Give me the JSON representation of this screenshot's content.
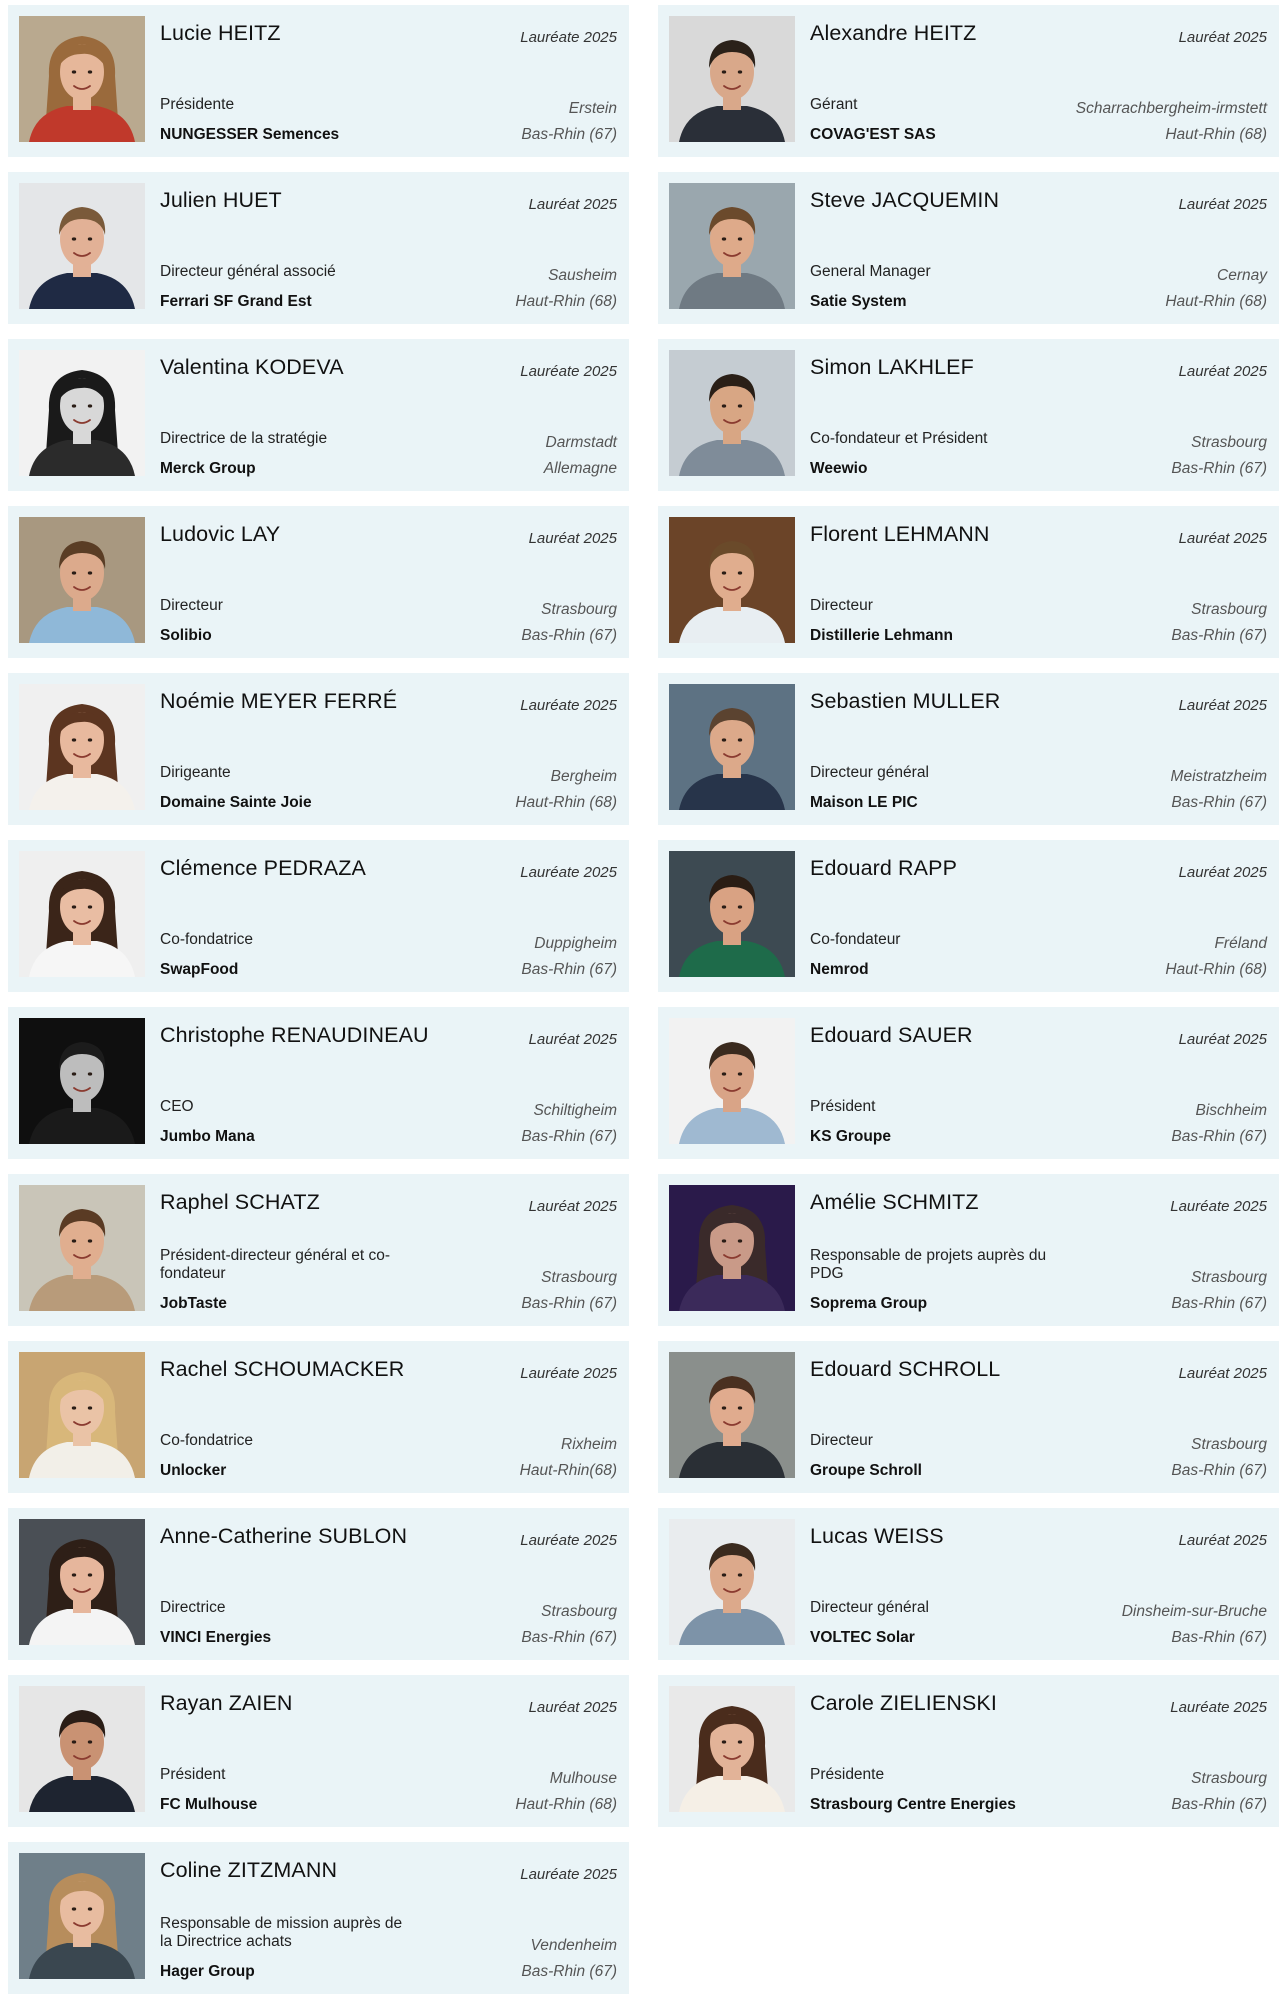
{
  "laureates": [
    {
      "name": "Lucie HEITZ",
      "badge": "Lauréate 2025",
      "role": "Présidente",
      "company": "NUNGESSER Semences",
      "city": "Erstein",
      "department": "Bas-Rhin (67)",
      "photo": {
        "bg": "#b9a98f",
        "skin": "#e6b79a",
        "hair": "#9a6a3c",
        "clothes": "#c0392b",
        "hair_long": true
      }
    },
    {
      "name": "Alexandre HEITZ",
      "badge": "Lauréat 2025",
      "role": "Gérant",
      "company": "COVAG'EST SAS",
      "city": "Scharrachbergheim-irmstett",
      "department": "Haut-Rhin (68)",
      "photo": {
        "bg": "#d9d9d9",
        "skin": "#d9a88a",
        "hair": "#2b2119",
        "clothes": "#2a2f38",
        "hair_long": false
      }
    },
    {
      "name": "Julien HUET",
      "badge": "Lauréat 2025",
      "role": "Directeur général associé",
      "company": "Ferrari SF Grand Est",
      "city": "Sausheim",
      "department": "Haut-Rhin (68)",
      "photo": {
        "bg": "#e4e6e8",
        "skin": "#e2b196",
        "hair": "#7a5a3a",
        "clothes": "#1f2a44",
        "hair_long": false
      }
    },
    {
      "name": "Steve JACQUEMIN",
      "badge": "Lauréat 2025",
      "role": "General Manager",
      "company": "Satie System",
      "city": "Cernay",
      "department": "Haut-Rhin (68)",
      "photo": {
        "bg": "#9aa7ae",
        "skin": "#deaa8a",
        "hair": "#6b4a2c",
        "clothes": "#6f7a83",
        "hair_long": false
      }
    },
    {
      "name": "Valentina KODEVA",
      "badge": "Lauréate 2025",
      "role": "Directrice de la stratégie",
      "company": "Merck Group",
      "city": "Darmstadt",
      "department": "Allemagne",
      "photo": {
        "bg": "#f2f2f2",
        "skin": "#d8d8d8",
        "hair": "#1a1a1a",
        "clothes": "#2b2b2b",
        "hair_long": true
      }
    },
    {
      "name": "Simon LAKHLEF",
      "badge": "Lauréat 2025",
      "role": "Co-fondateur et Président",
      "company": "Weewio",
      "city": "Strasbourg",
      "department": "Bas-Rhin (67)",
      "photo": {
        "bg": "#c5ccd2",
        "skin": "#d8a684",
        "hair": "#2a1f17",
        "clothes": "#7f8c99",
        "hair_long": false
      }
    },
    {
      "name": "Ludovic LAY",
      "badge": "Lauréat 2025",
      "role": "Directeur",
      "company": "Solibio",
      "city": "Strasbourg",
      "department": "Bas-Rhin (67)",
      "photo": {
        "bg": "#a89880",
        "skin": "#dcaa8c",
        "hair": "#5a3d25",
        "clothes": "#8fb8d8",
        "hair_long": false
      }
    },
    {
      "name": "Florent LEHMANN",
      "badge": "Lauréat 2025",
      "role": "Directeur",
      "company": "Distillerie Lehmann",
      "city": "Strasbourg",
      "department": "Bas-Rhin (67)",
      "photo": {
        "bg": "#6b4428",
        "skin": "#e0ad8e",
        "hair": "#6a4a2a",
        "clothes": "#e8eef2",
        "hair_long": false
      }
    },
    {
      "name": "Noémie MEYER FERRÉ",
      "badge": "Lauréate 2025",
      "role": "Dirigeante",
      "company": "Domaine Sainte Joie",
      "city": "Bergheim",
      "department": "Haut-Rhin (68)",
      "photo": {
        "bg": "#f0f0f0",
        "skin": "#e8b99e",
        "hair": "#5c3520",
        "clothes": "#f4f1ec",
        "hair_long": true
      }
    },
    {
      "name": "Sebastien MULLER",
      "badge": "Lauréat 2025",
      "role": "Directeur général",
      "company": "Maison LE PIC",
      "city": "Meistratzheim",
      "department": "Bas-Rhin (67)",
      "photo": {
        "bg": "#5d7283",
        "skin": "#dca98a",
        "hair": "#5b4330",
        "clothes": "#27344a",
        "hair_long": false
      }
    },
    {
      "name": "Clémence PEDRAZA",
      "badge": "Lauréate 2025",
      "role": "Co-fondatrice",
      "company": "SwapFood",
      "city": "Duppigheim",
      "department": "Bas-Rhin (67)",
      "photo": {
        "bg": "#efefef",
        "skin": "#e9bda3",
        "hair": "#3b2519",
        "clothes": "#f6f6f6",
        "hair_long": true
      }
    },
    {
      "name": "Edouard RAPP",
      "badge": "Lauréat 2025",
      "role": "Co-fondateur",
      "company": "Nemrod",
      "city": "Fréland",
      "department": "Haut-Rhin (68)",
      "photo": {
        "bg": "#3d4a52",
        "skin": "#d9a283",
        "hair": "#2a1d14",
        "clothes": "#1e6b4a",
        "hair_long": false
      }
    },
    {
      "name": "Christophe RENAUDINEAU",
      "badge": "Lauréat 2025",
      "role": "CEO",
      "company": "Jumbo Mana",
      "city": "Schiltigheim",
      "department": "Bas-Rhin (67)",
      "photo": {
        "bg": "#0f0f0f",
        "skin": "#bdbdbd",
        "hair": "#1c1c1c",
        "clothes": "#1a1a1a",
        "hair_long": false
      }
    },
    {
      "name": "Edouard SAUER",
      "badge": "Lauréat 2025",
      "role": "Président",
      "company": "KS Groupe",
      "city": "Bischheim",
      "department": "Bas-Rhin (67)",
      "photo": {
        "bg": "#f2f2f2",
        "skin": "#d9a487",
        "hair": "#3a2a1e",
        "clothes": "#9fb9d1",
        "hair_long": false
      }
    },
    {
      "name": "Raphel SCHATZ",
      "badge": "Lauréat 2025",
      "role": "Président-directeur général et co-fondateur",
      "company": "JobTaste",
      "city": "Strasbourg",
      "department": "Bas-Rhin (67)",
      "photo": {
        "bg": "#c9c5b8",
        "skin": "#e0ae8f",
        "hair": "#5a3b24",
        "clothes": "#b89b7a",
        "hair_long": false
      }
    },
    {
      "name": "Amélie SCHMITZ",
      "badge": "Lauréate 2025",
      "role": "Responsable de projets auprès du PDG",
      "company": "Soprema Group",
      "city": "Strasbourg",
      "department": "Bas-Rhin (67)",
      "photo": {
        "bg": "#2a1a4a",
        "skin": "#c99a88",
        "hair": "#3a2a2a",
        "clothes": "#3b2a5a",
        "hair_long": true
      }
    },
    {
      "name": "Rachel SCHOUMACKER",
      "badge": "Lauréate 2025",
      "role": "Co-fondatrice",
      "company": "Unlocker",
      "city": "Rixheim",
      "department": "Haut-Rhin(68)",
      "photo": {
        "bg": "#c8a572",
        "skin": "#eac3a6",
        "hair": "#d8b77a",
        "clothes": "#f2efe8",
        "hair_long": true
      }
    },
    {
      "name": "Edouard SCHROLL",
      "badge": "Lauréat 2025",
      "role": "Directeur",
      "company": "Groupe Schroll",
      "city": "Strasbourg",
      "department": "Bas-Rhin (67)",
      "photo": {
        "bg": "#8a8f8c",
        "skin": "#e0ab8e",
        "hair": "#4a3020",
        "clothes": "#2a2f35",
        "hair_long": false
      }
    },
    {
      "name": "Anne-Catherine SUBLON",
      "badge": "Lauréate 2025",
      "role": "Directrice",
      "company": "VINCI Energies",
      "city": "Strasbourg",
      "department": "Bas-Rhin (67)",
      "photo": {
        "bg": "#4a4f55",
        "skin": "#e6b69c",
        "hair": "#2e1f17",
        "clothes": "#f4f4f4",
        "hair_long": true
      }
    },
    {
      "name": "Lucas WEISS",
      "badge": "Lauréat 2025",
      "role": "Directeur général",
      "company": "VOLTEC Solar",
      "city": "Dinsheim-sur-Bruche",
      "department": "Bas-Rhin (67)",
      "photo": {
        "bg": "#e9ecee",
        "skin": "#dca98b",
        "hair": "#3a2a1e",
        "clothes": "#7d93a8",
        "hair_long": false
      }
    },
    {
      "name": "Rayan ZAIEN",
      "badge": "Lauréat 2025",
      "role": "Président",
      "company": "FC Mulhouse",
      "city": "Mulhouse",
      "department": "Haut-Rhin (68)",
      "photo": {
        "bg": "#e6e6e6",
        "skin": "#c99273",
        "hair": "#2a1d16",
        "clothes": "#1e2430",
        "hair_long": false
      }
    },
    {
      "name": "Carole ZIELIENSKI",
      "badge": "Lauréate 2025",
      "role": "Présidente",
      "company": "Strasbourg Centre Energies",
      "city": "Strasbourg",
      "department": "Bas-Rhin (67)",
      "photo": {
        "bg": "#e9e9e9",
        "skin": "#e2b398",
        "hair": "#4a2c1c",
        "clothes": "#f5efe6",
        "hair_long": true
      }
    },
    {
      "name": "Coline ZITZMANN",
      "badge": "Lauréate 2025",
      "role": "Responsable de mission auprès de la Directrice achats",
      "company": "Hager Group",
      "city": "Vendenheim",
      "department": "Bas-Rhin (67)",
      "photo": {
        "bg": "#6f7f89",
        "skin": "#e8bca0",
        "hair": "#b78d5c",
        "clothes": "#3a4750",
        "hair_long": true
      }
    }
  ]
}
